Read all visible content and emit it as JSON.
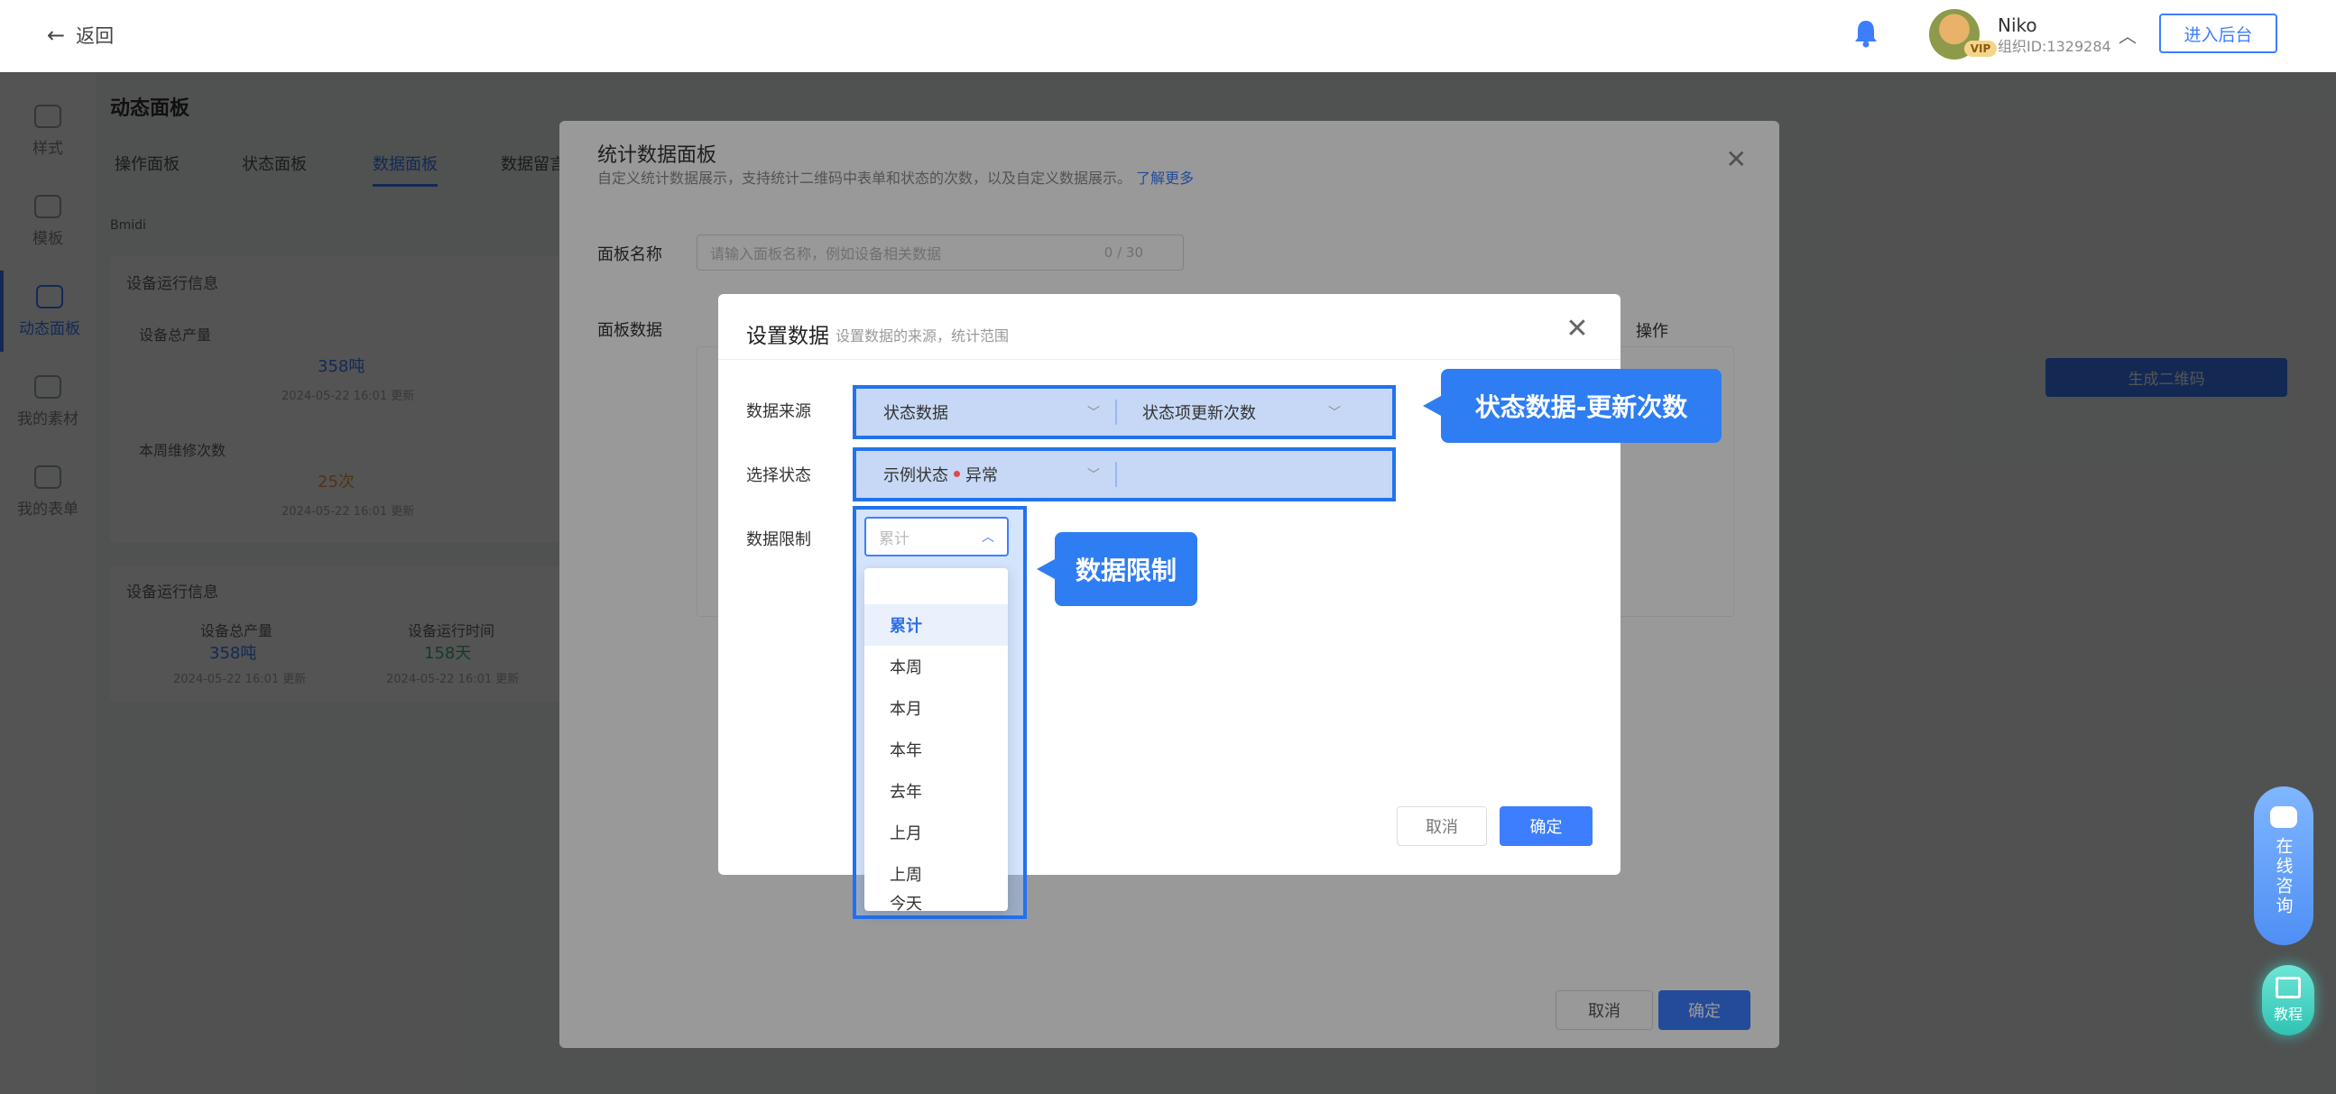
{
  "header": {
    "back_label": "返回",
    "user_name": "Niko",
    "user_org": "组织ID:1329284",
    "vip_badge": "VIP",
    "admin_button": "进入后台"
  },
  "background": {
    "sidebar": [
      "样式",
      "模板",
      "动态面板",
      "我的素材",
      "我的表单"
    ],
    "page_title": "动态面板",
    "tabs": [
      "操作面板",
      "状态面板",
      "数据面板",
      "数据留言"
    ],
    "info_label": "Bmidi",
    "card1_title": "设备运行信息",
    "card1_items": [
      {
        "label": "设备总产量",
        "value": "358吨",
        "time": "2024-05-22 16:01 更新"
      },
      {
        "label": "本周维修次数",
        "value": "25次",
        "time": "2024-05-22 16:01 更新"
      }
    ],
    "card2_title": "设备运行信息",
    "card2_items": [
      {
        "label": "设备总产量",
        "value": "358吨",
        "time": "2024-05-22 16:01 更新"
      },
      {
        "label": "设备运行时间",
        "value": "158天",
        "time": "2024-05-22 16:01 更新"
      }
    ],
    "qr_button": "生成二维码"
  },
  "panel_modal": {
    "title": "统计数据面板",
    "subtitle": "自定义统计数据展示，支持统计二维码中表单和状态的次数，以及自定义数据展示。",
    "learn_more": "了解更多",
    "name_label": "面板名称",
    "name_placeholder": "请输入面板名称，例如设备相关数据",
    "name_count": "0 / 30",
    "data_label": "面板数据",
    "column_action": "操作",
    "cancel": "取消",
    "ok": "确定"
  },
  "data_modal": {
    "title": "设置数据",
    "subtitle": "设置数据的来源，统计范围",
    "source_label": "数据来源",
    "source_value": "状态数据",
    "source_item": "状态项更新次数",
    "status_label": "选择状态",
    "status_value": "示例状态",
    "status_option": "异常",
    "limit_label": "数据限制",
    "limit_value": "累计",
    "limit_options": [
      "累计",
      "本周",
      "本月",
      "本年",
      "去年",
      "上月",
      "上周",
      "今天"
    ],
    "cancel": "取消",
    "ok": "确定"
  },
  "callouts": {
    "source": "状态数据-更新次数",
    "limit": "数据限制"
  },
  "widgets": {
    "consult": "在线咨询",
    "tutorial": "教程"
  },
  "colors": {
    "accent": "#3d7eff",
    "highlight_border": "#2372ec",
    "callout": "#2e7df2",
    "danger_dot": "#e34848"
  }
}
